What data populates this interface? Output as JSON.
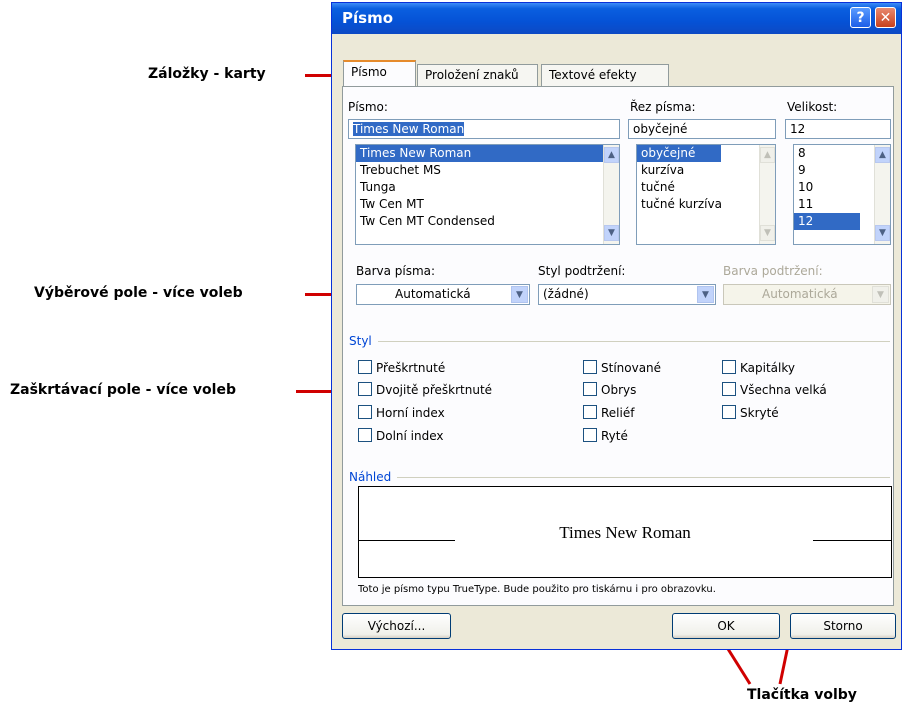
{
  "annotations": {
    "tabs": "Záložky - karty",
    "dropdowns": "Výběrové pole - více voleb",
    "checkboxes": "Zaškrtávací pole - více voleb",
    "buttons": "Tlačítka volby"
  },
  "dialog": {
    "title": "Písmo",
    "help_symbol": "?",
    "close_symbol": "✕",
    "tabs": [
      "Písmo",
      "Proložení znaků",
      "Textové efekty"
    ]
  },
  "font": {
    "label": "Písmo:",
    "value": "Times New Roman",
    "items": [
      "Times New Roman",
      "Trebuchet MS",
      "Tunga",
      "Tw Cen MT",
      "Tw Cen MT Condensed"
    ],
    "selected": "Times New Roman"
  },
  "style": {
    "label": "Řez písma:",
    "value": "obyčejné",
    "items": [
      "obyčejné",
      "kurzíva",
      "tučné",
      "tučné kurzíva"
    ],
    "selected": "obyčejné"
  },
  "size": {
    "label": "Velikost:",
    "value": "12",
    "items": [
      "8",
      "9",
      "10",
      "11",
      "12"
    ],
    "selected": "12"
  },
  "font_color": {
    "label": "Barva písma:",
    "value": "Automatická"
  },
  "underline_style": {
    "label": "Styl podtržení:",
    "value": "(žádné)"
  },
  "underline_color": {
    "label": "Barva podtržení:",
    "value": "Automatická"
  },
  "effects": {
    "label": "Styl",
    "col1": [
      "Přeškrtnuté",
      "Dvojitě přeškrtnuté",
      "Horní index",
      "Dolní index"
    ],
    "col2": [
      "Stínované",
      "Obrys",
      "Reliéf",
      "Ryté"
    ],
    "col3": [
      "Kapitálky",
      "Všechna velká",
      "Skryté"
    ]
  },
  "preview": {
    "label": "Náhled",
    "sample": "Times New Roman",
    "note": "Toto je písmo typu TrueType. Bude použito pro tiskárnu i pro obrazovku."
  },
  "buttons": {
    "default": "Výchozí...",
    "ok": "OK",
    "cancel": "Storno"
  },
  "colors": {
    "accent": "#316ac5",
    "annotation": "#d00000",
    "titlebar": "#0552d6",
    "dialog_bg": "#ece9d8"
  }
}
